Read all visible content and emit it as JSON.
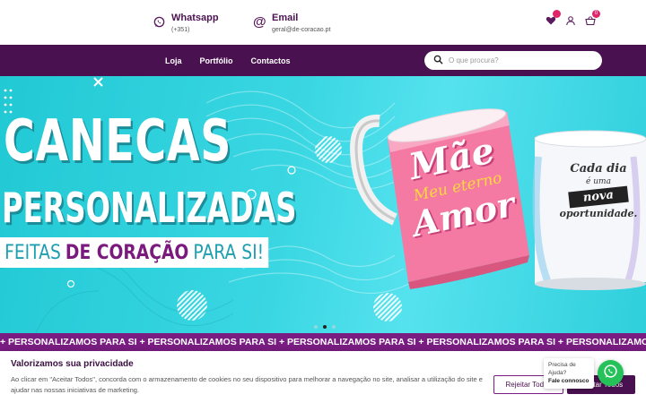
{
  "contacts": {
    "whatsapp_title": "Whatsapp",
    "whatsapp_sub": "(+351)",
    "email_title": "Email",
    "email_sub": "geral@de-coracao.pt"
  },
  "header_icons": {
    "wishlist_icon": "heart-icon",
    "account_icon": "user-icon",
    "cart_icon": "basket-icon",
    "cart_count": "0"
  },
  "nav": {
    "items": [
      {
        "label": "Loja"
      },
      {
        "label": "Portfólio"
      },
      {
        "label": "Contactos"
      }
    ]
  },
  "search": {
    "placeholder": "O que procura?"
  },
  "hero": {
    "line1": "CANECAS",
    "line2": "PERSONALIZADAS",
    "sub_part1": "FEITAS",
    "sub_highlight": "DE CORAÇÃO",
    "sub_part2": "PARA SI!",
    "mug1_line1": "Mãe",
    "mug1_line2": "Meu eterno",
    "mug1_line3": "Amor",
    "mug2_line1": "Cada dia",
    "mug2_line2": "é uma",
    "mug2_line3": "nova",
    "mug2_line4": "oportunidade.",
    "slide_count": 3,
    "active_slide": 2
  },
  "marquee": {
    "text": "+ PERSONALIZAMOS PARA SI + PERSONALIZAMOS PARA SI + PERSONALIZAMOS PARA SI + PERSONALIZAMOS PARA SI + PERSONALIZAMOS PARA SI + PERSONALIZAMOS PARA SI"
  },
  "cookie": {
    "title": "Valorizamos sua privacidade",
    "text": "Ao clicar em \"Aceitar Todos\", concorda com o armazenamento de cookies no seu dispositivo para melhorar a navegação no site, analisar a utilização do site e ajudar nas nossas iniciativas de marketing.",
    "reject_label": "Rejeitar Todos",
    "accept_label": "Aceitar Todos"
  },
  "whatsapp_widget": {
    "line1": "Precisa de Ajuda?",
    "line2": "Fale connosco"
  },
  "colors": {
    "brand_purple": "#4a1150",
    "marquee_purple": "#7a1d83",
    "hero_teal": "#3ad7e3",
    "whatsapp_green": "#25c25a"
  }
}
